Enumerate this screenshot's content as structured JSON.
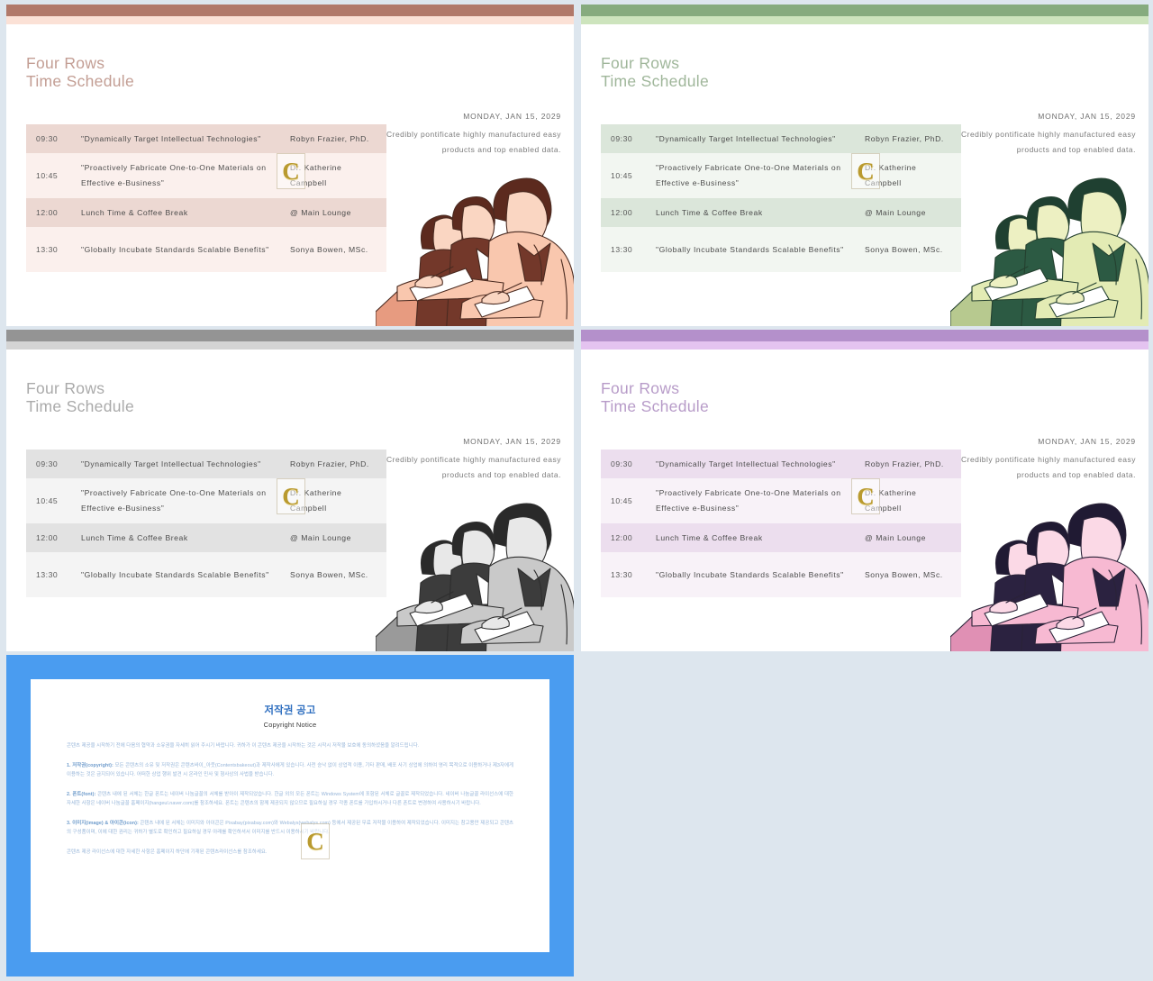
{
  "background_color": "#dde6ee",
  "watermark": {
    "letter": "C",
    "name": "copyright-watermark"
  },
  "slide_common": {
    "title": "Four Rows\nTime Schedule",
    "date": "MONDAY, JAN 15, 2029",
    "blurb": "Credibly pontificate highly manufactured easy products and top enabled data.",
    "table": {
      "rows": [
        {
          "time": "09:30",
          "topic": "\"Dynamically Target Intellectual Technologies\"",
          "who": "Robyn Frazier, PhD."
        },
        {
          "time": "10:45",
          "topic": "\"Proactively Fabricate One-to-One Materials on Effective e-Business\"",
          "who": "Dr. Katherine Campbell"
        },
        {
          "time": "12:00",
          "topic": "Lunch Time & Coffee Break",
          "who": "@ Main Lounge"
        },
        {
          "time": "13:30",
          "topic": "\"Globally Incubate Standards Scalable Benefits\"",
          "who": "Sonya Bowen, MSc."
        }
      ]
    }
  },
  "slides": [
    {
      "id": "slide-brown",
      "bar_dark": "#b1796a",
      "bar_light": "#fbe1d6",
      "title_color": "#c39e94",
      "row_odd": "#ecd8d2",
      "row_even": "#fbf0ed",
      "illo": {
        "skin": "#fad6c2",
        "hair": "#5c2a1e",
        "suit_dark": "#73382a",
        "suit_light": "#f9c7ae",
        "line": "#4a2a20",
        "chair": "#e79b80"
      }
    },
    {
      "id": "slide-green",
      "bar_dark": "#86ab7e",
      "bar_light": "#cde4bd",
      "title_color": "#9fb69a",
      "row_odd": "#dbe6da",
      "row_even": "#f2f6f1",
      "illo": {
        "skin": "#edf0c2",
        "hair": "#1f4031",
        "suit_dark": "#2c5a43",
        "suit_light": "#e3ebb4",
        "line": "#24402f",
        "chair": "#b7c98f"
      }
    },
    {
      "id": "slide-gray",
      "bar_dark": "#949494",
      "bar_light": "#d4d4d4",
      "title_color": "#aaaaaa",
      "row_odd": "#e2e2e2",
      "row_even": "#f4f4f4",
      "illo": {
        "skin": "#e8e8e8",
        "hair": "#2a2a2a",
        "suit_dark": "#3c3c3c",
        "suit_light": "#c9c9c9",
        "line": "#2e2e2e",
        "chair": "#9a9a9a"
      }
    },
    {
      "id": "slide-purple",
      "bar_dark": "#b490cb",
      "bar_light": "#e4c3f0",
      "title_color": "#b79bc8",
      "row_odd": "#ecdeee",
      "row_even": "#f8f2f8",
      "illo": {
        "skin": "#fbd9e6",
        "hair": "#201a33",
        "suit_dark": "#2b2240",
        "suit_light": "#f7b9d2",
        "line": "#2a2238",
        "chair": "#e090b4"
      }
    }
  ],
  "copyright": {
    "border_color": "#4a9cf0",
    "heading_ko": "저작권 공고",
    "heading_en": "Copyright Notice",
    "intro": "콘텐츠 제공을 시작하기 전에 다음의 협약과 소유권을 자세히 읽어 주시기 바랍니다. 귀하가 이 콘텐츠 제공을 시작하는 것은 시작시 저작물 보호에 동의하셨음을 알려드립니다.",
    "sections": [
      {
        "label": "1. 저작권(copyright):",
        "text": " 모든 콘텐츠의 소유 및 저작권은 콘텐츠바이_아웃(Contentsbakeout)과 제작사에게 있습니다. 사전 승낙 없이 상업적 이용, 기타 판매, 배포 사기 상업에 의하여 영리 목적으로 이용하거나 제3자에게 이용하는 것은 금지되어 있습니다. 어떠한 상업 행위 발견 시 온라인 민사 및 형사상의 사법을 받습니다."
      },
      {
        "label": "2. 폰트(font):",
        "text": " 콘텐츠 내에 된 서체는 한글 폰트는 네이버 나눔글꼴의 서체를 받아이 제작되었습니다. 한글 외의 모든 폰트는 Windows System에 포함된 서체로 글꼴로 제작되었습니다. 네이버 나눔글꼴 라이선스에 대한 자세한 사항은 네이버 나눔글꼴 홈페이지(hangeul.naver.com)를 참조하세요. 폰트는 콘텐츠의 함께 제공되지 않으므로 필요하실 경우 각종 폰트를 가입하시거나 다른 폰트로 변경하여 사용하시기 바랍니다."
      },
      {
        "label": "3. 이미지(image) & 아이콘(icon):",
        "text": " 콘텐츠 내에 된 서체는 이미지와 아이콘은 Pixabay(pixabay.com)와 Webalys(webalys.com) 등에서 제공된 무료 저작물 이용하여 제작되었습니다. 이미지는 참고용만 제공되고 콘텐츠의 구성품이며, 이에 대한 권리는 귀하가 별도로 확인하고 필요하실 경우 아래를 확인하셔서 이미지를 반드시 이용하시기 바랍니다."
      }
    ],
    "footer": "콘텐츠 제공 라이선스에 대한 자세한 사항은 홈페이지 하단에 기재된 콘텐츠라이선스를 참조하세요."
  }
}
